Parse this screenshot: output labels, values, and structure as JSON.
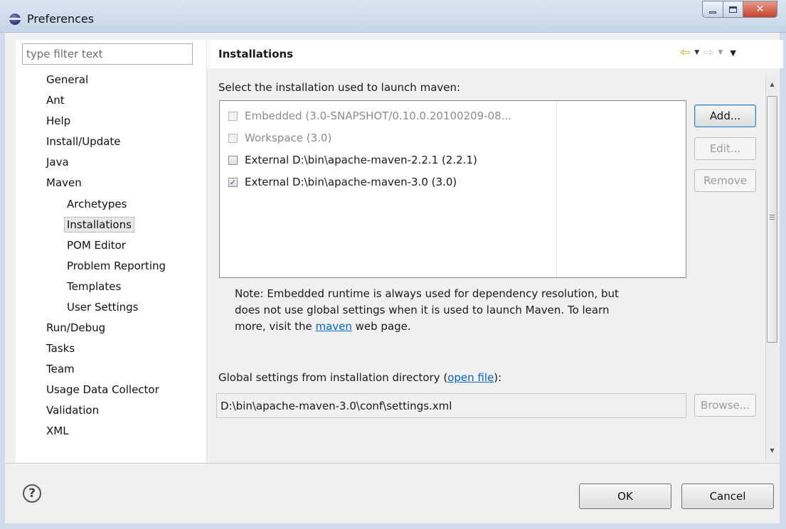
{
  "window": {
    "title": "Preferences",
    "minimize_icon": "minimize-icon",
    "maximize_icon": "maximize-icon",
    "close_icon": "close-icon"
  },
  "sidebar": {
    "filter_placeholder": "type filter text",
    "items": [
      {
        "label": "General"
      },
      {
        "label": "Ant"
      },
      {
        "label": "Help"
      },
      {
        "label": "Install/Update"
      },
      {
        "label": "Java"
      },
      {
        "label": "Maven"
      },
      {
        "label": "Archetypes"
      },
      {
        "label": "Installations",
        "selected": true
      },
      {
        "label": "POM Editor"
      },
      {
        "label": "Problem Reporting"
      },
      {
        "label": "Templates"
      },
      {
        "label": "User Settings"
      },
      {
        "label": "Run/Debug"
      },
      {
        "label": "Tasks"
      },
      {
        "label": "Team"
      },
      {
        "label": "Usage Data Collector"
      },
      {
        "label": "Validation"
      },
      {
        "label": "XML"
      }
    ]
  },
  "page": {
    "title": "Installations",
    "nav": {
      "back_icon": "back-arrow-icon",
      "forward_icon": "forward-arrow-icon",
      "menu_icon": "view-menu-icon"
    },
    "select_label": "Select the installation used to launch maven:",
    "installations": [
      {
        "label": "Embedded (3.0-SNAPSHOT/0.10.0.20100209-08...",
        "checked": false,
        "enabled": false
      },
      {
        "label": "Workspace (3.0)",
        "checked": false,
        "enabled": false
      },
      {
        "label": "External D:\\bin\\apache-maven-2.2.1 (2.2.1)",
        "checked": false,
        "enabled": true
      },
      {
        "label": "External D:\\bin\\apache-maven-3.0 (3.0)",
        "checked": true,
        "enabled": true
      }
    ],
    "buttons": {
      "add": "Add...",
      "edit": "Edit...",
      "remove": "Remove",
      "browse": "Browse..."
    },
    "note": {
      "line1": "Note: Embedded runtime is always used for dependency resolution, but",
      "line2": "does not use global settings when it is used to launch Maven. To learn",
      "line3_prefix": "more, visit the ",
      "line3_link": "maven",
      "line3_suffix": " web page."
    },
    "global_settings": {
      "label_prefix": "Global settings from installation directory (",
      "link": "open file",
      "label_suffix": "):",
      "value": "D:\\bin\\apache-maven-3.0\\conf\\settings.xml"
    }
  },
  "footer": {
    "help_icon": "help-icon",
    "ok": "OK",
    "cancel": "Cancel"
  }
}
